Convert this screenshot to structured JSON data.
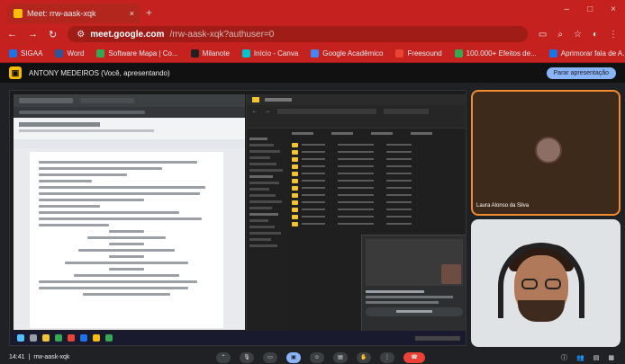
{
  "browser": {
    "tab_title": "Meet: rrw-aask-xqk",
    "url_host": "meet.google.com",
    "url_path": "/rrw-aask-xqk?authuser=0",
    "bookmarks": [
      {
        "label": "SIGAA",
        "color": "#1a73e8"
      },
      {
        "label": "Word",
        "color": "#2b579a"
      },
      {
        "label": "Software Mapa | Co...",
        "color": "#34a853"
      },
      {
        "label": "Milanote",
        "color": "#202124"
      },
      {
        "label": "Início - Canva",
        "color": "#00c4cc"
      },
      {
        "label": "Google Acadêmico",
        "color": "#4285f4"
      },
      {
        "label": "Freesound",
        "color": "#ea4335"
      },
      {
        "label": "100.000+ Efeitos de...",
        "color": "#34a853"
      },
      {
        "label": "Aprimorar fala de A...",
        "color": "#1a73e8"
      }
    ]
  },
  "presentation": {
    "presenter": "ANTONY MEDEIROS (Você, apresentando)",
    "stop_label": "Parar apresentação"
  },
  "participants": [
    {
      "name": "Laura Alonso da Silva"
    }
  ],
  "meeting": {
    "time": "14:41",
    "code": "rrw-aask-xqk"
  },
  "colors": {
    "chrome_red": "#c5221f",
    "active_speaker_border": "#f28b30",
    "end_call": "#ea4335",
    "accent_blue": "#8ab4f8"
  }
}
